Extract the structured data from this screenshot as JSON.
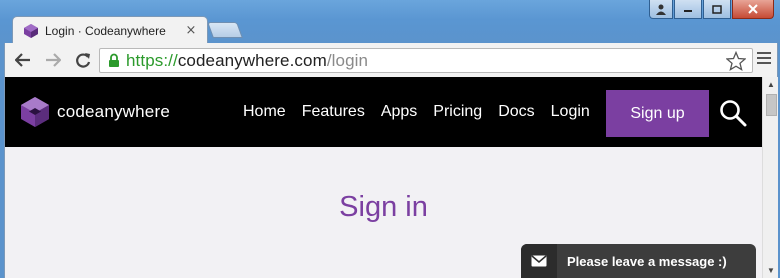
{
  "browser": {
    "tab_title": "Login · Codeanywhere",
    "tab_close": "×",
    "url_scheme": "https://",
    "url_host": "codeanywhere.com",
    "url_path": "/login",
    "window_controls": [
      "user-icon",
      "minimize-icon",
      "maximize-icon",
      "close-icon"
    ]
  },
  "site": {
    "logo_text": "codeanywhere",
    "nav_links": [
      "Home",
      "Features",
      "Apps",
      "Pricing",
      "Docs",
      "Login"
    ],
    "signup_label": "Sign up",
    "brand_color": "#7b3fa1"
  },
  "main": {
    "title": "Sign in"
  },
  "chat": {
    "label": "Please leave a message :)"
  }
}
